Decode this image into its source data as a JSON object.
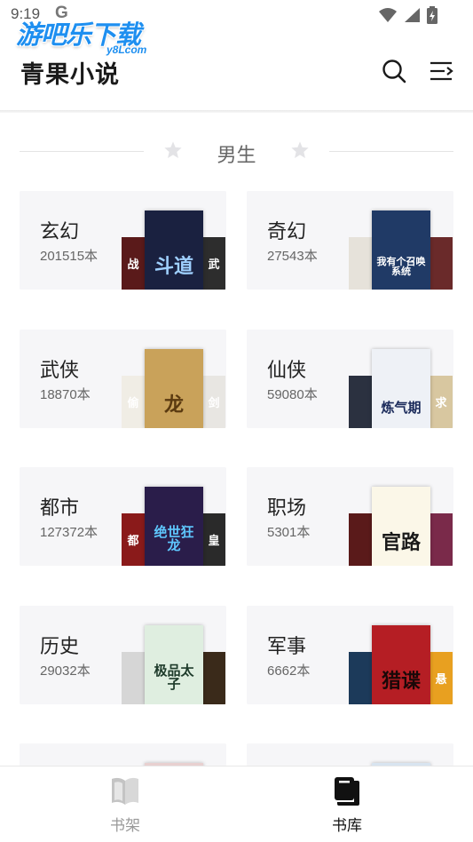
{
  "status_bar": {
    "time": "9:19",
    "g_label": "G"
  },
  "watermark": {
    "main": "游吧乐下载",
    "sub": "y8Lcom"
  },
  "app_bar": {
    "title": "青果小说",
    "search_icon": "search-icon",
    "menu_icon": "menu-icon"
  },
  "section": {
    "title": "男生"
  },
  "categories": [
    {
      "name": "玄幻",
      "count": "201515本",
      "front_text": "斗道",
      "front_bg": "#1a2140",
      "front_fg": "#9fd0ff",
      "back_l_text": "战",
      "back_l_bg": "#5a1a1a",
      "back_r_text": "武",
      "back_r_bg": "#2d2d2d"
    },
    {
      "name": "奇幻",
      "count": "27543本",
      "front_text": "我有个召唤系统",
      "front_bg": "#203a66",
      "front_fg": "#ffffff",
      "back_l_text": "",
      "back_l_bg": "#e6e2da",
      "back_r_text": "",
      "back_r_bg": "#6a2a2a"
    },
    {
      "name": "武侠",
      "count": "18870本",
      "front_text": "龙",
      "front_bg": "#c9a25a",
      "front_fg": "#5a3a10",
      "back_l_text": "偷",
      "back_l_bg": "#f0ede5",
      "back_r_text": "剑",
      "back_r_bg": "#e8e6e2"
    },
    {
      "name": "仙侠",
      "count": "59080本",
      "front_text": "炼气期",
      "front_bg": "#eef1f6",
      "front_fg": "#1a2a5a",
      "back_l_text": "",
      "back_l_bg": "#2b3140",
      "back_r_text": "求",
      "back_r_bg": "#d8c7a0"
    },
    {
      "name": "都市",
      "count": "127372本",
      "front_text": "绝世狂龙",
      "front_bg": "#2a1d4a",
      "front_fg": "#5fc8ff",
      "back_l_text": "都",
      "back_l_bg": "#8a1a1a",
      "back_r_text": "皇",
      "back_r_bg": "#2a2a2a"
    },
    {
      "name": "职场",
      "count": "5301本",
      "front_text": "官路",
      "front_bg": "#fbf7e8",
      "front_fg": "#1a1a1a",
      "back_l_text": "",
      "back_l_bg": "#5a1a1a",
      "back_r_text": "",
      "back_r_bg": "#7a2a4a"
    },
    {
      "name": "历史",
      "count": "29032本",
      "front_text": "极品太子",
      "front_bg": "#dfeee0",
      "front_fg": "#1d3a2a",
      "back_l_text": "",
      "back_l_bg": "#d6d6d6",
      "back_r_text": "",
      "back_r_bg": "#3a2a1a"
    },
    {
      "name": "军事",
      "count": "6662本",
      "front_text": "猎谍",
      "front_bg": "#b51e24",
      "front_fg": "#1a0808",
      "back_l_text": "",
      "back_l_bg": "#1c3a5a",
      "back_r_text": "悬",
      "back_r_bg": "#e8a020"
    },
    {
      "name": "",
      "count": "",
      "front_text": "",
      "front_bg": "#e8d0d0",
      "front_fg": "#333",
      "back_l_text": "",
      "back_l_bg": "#f6f6f8",
      "back_r_text": "",
      "back_r_bg": "#f6f6f8"
    },
    {
      "name": "",
      "count": "",
      "front_text": "",
      "front_bg": "#d8e4f0",
      "front_fg": "#333",
      "back_l_text": "",
      "back_l_bg": "#f6f6f8",
      "back_r_text": "",
      "back_r_bg": "#f6f6f8"
    }
  ],
  "bottom_nav": [
    {
      "label": "书架",
      "icon": "book-open-icon",
      "color": "#999999"
    },
    {
      "label": "书库",
      "icon": "books-icon",
      "color": "#111111"
    }
  ]
}
